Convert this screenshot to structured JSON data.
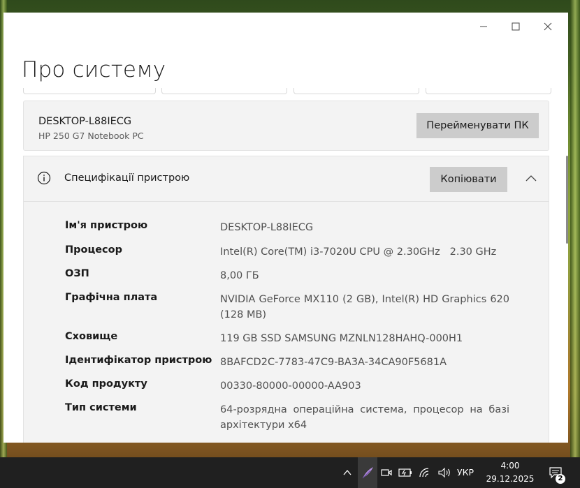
{
  "window": {
    "title": "Про систему",
    "device": {
      "name": "DESKTOP-L88IECG",
      "model": "HP 250 G7 Notebook PC",
      "rename_label": "Перейменувати ПК"
    },
    "specs": {
      "title": "Специфікації пристрою",
      "copy_label": "Копіювати",
      "rows": [
        {
          "label": "Ім'я пристрою",
          "value": "DESKTOP-L88IECG"
        },
        {
          "label": "Процесор",
          "value": "Intel(R) Core(TM) i3-7020U CPU @ 2.30GHz   2.30 GHz"
        },
        {
          "label": "ОЗП",
          "value": "8,00 ГБ"
        },
        {
          "label": "Графічна плата",
          "value": "NVIDIA GeForce MX110 (2 GB), Intel(R) HD Graphics 620 (128 MB)"
        },
        {
          "label": "Сховище",
          "value": "119 GB SSD SAMSUNG MZNLN128HAHQ-000H1"
        },
        {
          "label": "Ідентифікатор пристрою",
          "value": "8BAFCD2C-7783-47C9-BA3A-34CA90F5681A"
        },
        {
          "label": "Код продукту",
          "value": "00330-80000-00000-AA903"
        },
        {
          "label": "Тип системи",
          "value": "64-розрядна операційна система, процесор на базі архітектури x64"
        }
      ]
    }
  },
  "taskbar": {
    "language": "УКР",
    "time": "4:00",
    "date": "29.12.2025",
    "notification_count": "2"
  },
  "icons": {
    "info": "info-icon",
    "chevron": "chevron-up-icon",
    "minimize": "minimize-icon",
    "maximize": "maximize-icon",
    "close": "close-icon"
  },
  "colors": {
    "window_bg": "#ffffff",
    "panel_bg": "#f3f3f3",
    "button_bg": "#cccccc",
    "taskbar_bg": "#202020",
    "accent_feather": "#b48ee0"
  }
}
